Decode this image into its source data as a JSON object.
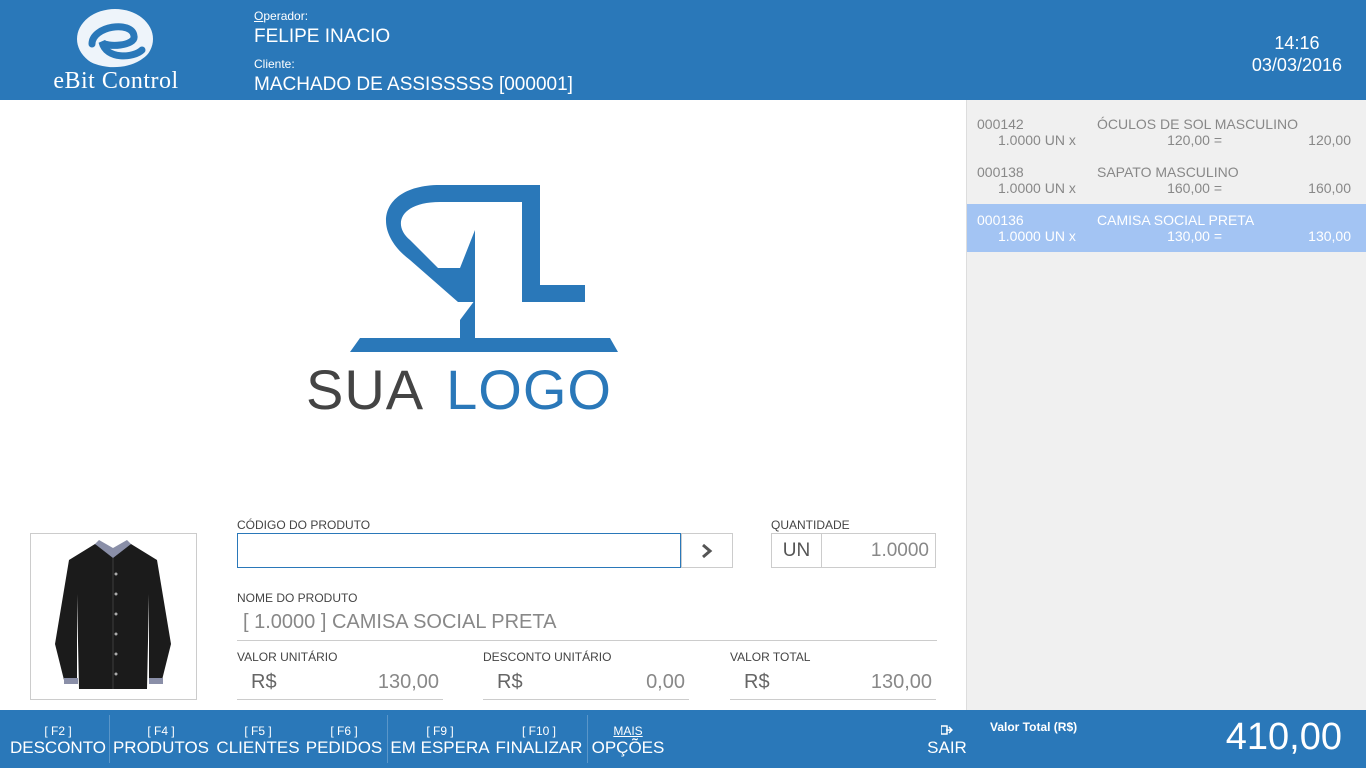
{
  "header": {
    "brand": "eBit Control",
    "operator_label_first": "O",
    "operator_label_rest": "perador:",
    "operator_name": "FELIPE INACIO",
    "client_label": "Cliente:",
    "client_name": "MACHADO DE ASSISSSSS [000001]",
    "time": "14:16",
    "date": "03/03/2016"
  },
  "logo": {
    "word1": "SUA",
    "word2": "LOGO"
  },
  "form": {
    "code_label": "CÓDIGO DO PRODUTO",
    "code_value": "",
    "quantity_label": "QUANTIDADE",
    "quantity_unit": "UN",
    "quantity_value": "1.0000",
    "name_label": "NOME DO PRODUTO",
    "name_value": "[ 1.0000 ] CAMISA SOCIAL PRETA",
    "unit_price_label": "VALOR UNITÁRIO",
    "unit_price_currency": "R$",
    "unit_price_value": "130,00",
    "discount_label": "DESCONTO UNITÁRIO",
    "discount_currency": "R$",
    "discount_value": "0,00",
    "total_label": "VALOR TOTAL",
    "total_currency": "R$",
    "total_value": "130,00"
  },
  "items": [
    {
      "code": "000142",
      "desc": "ÓCULOS DE SOL MASCULINO",
      "qty": "1.0000 UN x",
      "unit": "120,00 =",
      "total": "120,00"
    },
    {
      "code": "000138",
      "desc": "SAPATO MASCULINO",
      "qty": "1.0000 UN x",
      "unit": "160,00 =",
      "total": "160,00"
    },
    {
      "code": "000136",
      "desc": "CAMISA SOCIAL PRETA",
      "qty": "1.0000 UN x",
      "unit": "130,00 =",
      "total": "130,00"
    }
  ],
  "footer": {
    "keys": [
      {
        "key": "[ F2 ]",
        "label": "DESCONTO"
      },
      {
        "key": "[ F4 ]",
        "label": "PRODUTOS"
      },
      {
        "key": "[ F5 ]",
        "label": "CLIENTES"
      },
      {
        "key": "[ F6 ]",
        "label": "PEDIDOS"
      },
      {
        "key": "[ F9 ]",
        "label": "EM ESPERA"
      },
      {
        "key": "[ F10 ]",
        "label": "FINALIZAR"
      },
      {
        "key": "MAIS",
        "label": "OPÇÕES"
      }
    ],
    "exit_label": "SAIR",
    "total_label": "Valor Total (R$)",
    "total_value": "410,00"
  },
  "colors": {
    "accent": "#2a78b9",
    "selected_row": "#a3c4f3",
    "panel_bg": "#f0f0f0"
  }
}
